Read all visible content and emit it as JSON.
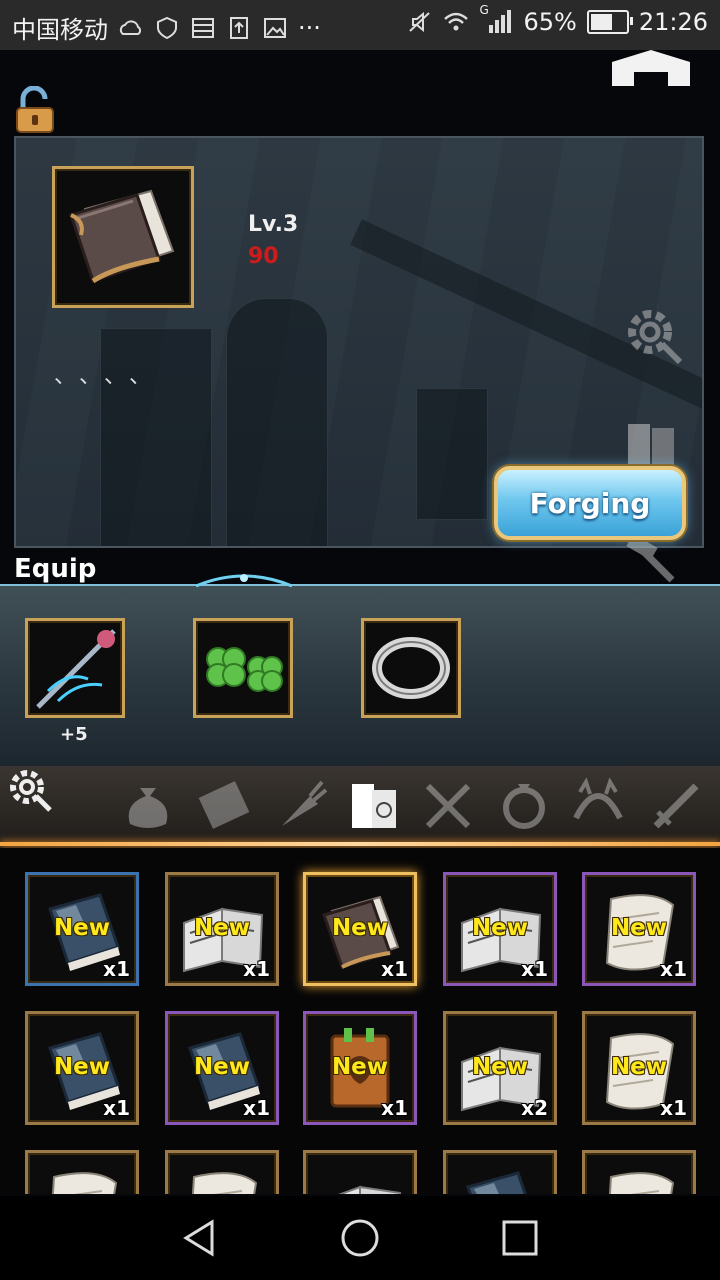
{
  "status_bar": {
    "carrier": "中国移动",
    "network_type": "G",
    "battery_percent": "65%",
    "battery_level": 0.65,
    "time": "21:26",
    "more": "···"
  },
  "item_detail": {
    "level": "Lv.3",
    "power": "90",
    "description": "、、、、",
    "forging_button": "Forging"
  },
  "equip": {
    "title": "Equip",
    "slots": [
      {
        "name": "staff",
        "level": "+5"
      },
      {
        "name": "clover",
        "level": ""
      },
      {
        "name": "ring",
        "level": ""
      }
    ]
  },
  "categories": [
    "bag",
    "envelope",
    "carrot",
    "books",
    "fork-knife",
    "ring",
    "headband",
    "sword"
  ],
  "active_category": "books",
  "inventory": {
    "rows": [
      [
        {
          "new": "New",
          "qty": "x1",
          "rarity": "blue",
          "art": "book-dark"
        },
        {
          "new": "New",
          "qty": "x1",
          "rarity": "bronze",
          "art": "book-open"
        },
        {
          "new": "New",
          "qty": "x1",
          "rarity": "selected",
          "art": "book-brown"
        },
        {
          "new": "New",
          "qty": "x1",
          "rarity": "purple",
          "art": "book-open"
        },
        {
          "new": "New",
          "qty": "x1",
          "rarity": "purple",
          "art": "scroll"
        }
      ],
      [
        {
          "new": "New",
          "qty": "x1",
          "rarity": "bronze",
          "art": "book-dark"
        },
        {
          "new": "New",
          "qty": "x1",
          "rarity": "purple",
          "art": "book-dark"
        },
        {
          "new": "New",
          "qty": "x1",
          "rarity": "purple",
          "art": "book-orange"
        },
        {
          "new": "New",
          "qty": "x2",
          "rarity": "bronze",
          "art": "book-open"
        },
        {
          "new": "New",
          "qty": "x1",
          "rarity": "bronze",
          "art": "scroll"
        }
      ],
      [
        {
          "new": "",
          "qty": "",
          "rarity": "bronze",
          "art": "scroll"
        },
        {
          "new": "",
          "qty": "",
          "rarity": "bronze",
          "art": "scroll"
        },
        {
          "new": "",
          "qty": "",
          "rarity": "bronze",
          "art": "book-open"
        },
        {
          "new": "",
          "qty": "",
          "rarity": "bronze",
          "art": "book-dark"
        },
        {
          "new": "",
          "qty": "",
          "rarity": "bronze",
          "art": "scroll"
        }
      ]
    ]
  },
  "colors": {
    "gold_frame": "#c9a25a",
    "new_label": "#ffe81a",
    "power_red": "#d11b1b",
    "forging_blue": "#6fc7ee",
    "category_glow": "#f4a440"
  }
}
